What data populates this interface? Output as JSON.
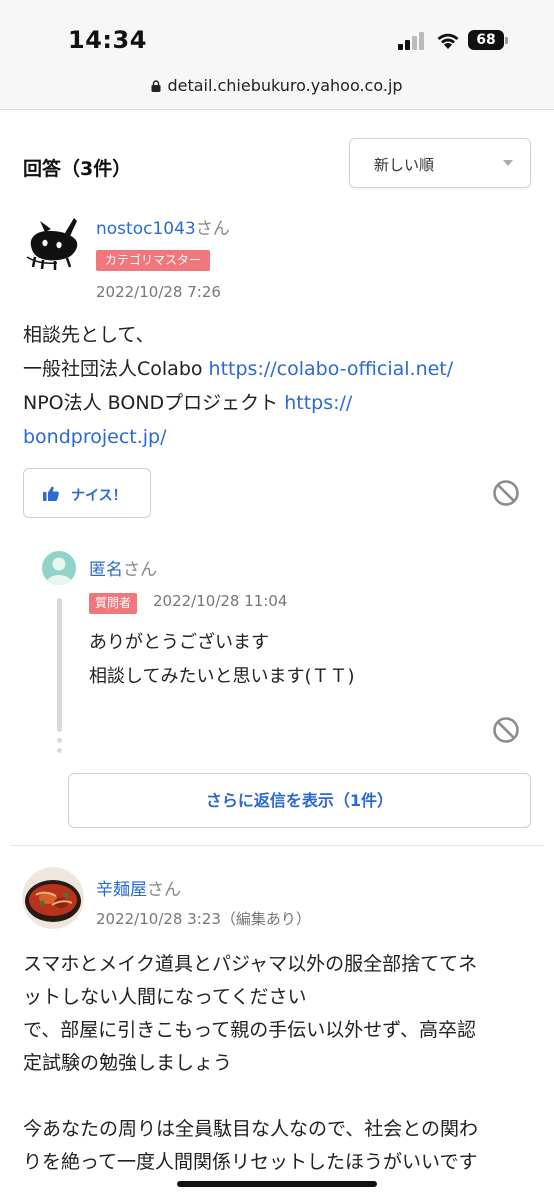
{
  "status_bar": {
    "time": "14:34",
    "battery": "68"
  },
  "browser": {
    "url": "detail.chiebukuro.yahoo.co.jp"
  },
  "answers_header": {
    "title": "回答（3件）",
    "sort_value": "新しい順"
  },
  "answer1": {
    "username": "nostoc1043",
    "suffix": "さん",
    "badge": "カテゴリマスター",
    "date": "2022/10/28 7:26",
    "lines": [
      {
        "text": "相談先として、",
        "link": ""
      },
      {
        "text": "一般社団法人Colabo ",
        "link": "https://colabo-official.net/"
      },
      {
        "text": "NPO法人 BONDプロジェクト ",
        "link": "https://"
      },
      {
        "text": "",
        "link": "bondproject.jp/"
      }
    ],
    "nice_label": "ナイス！"
  },
  "reply": {
    "username": "匿名",
    "suffix": "さん",
    "badge": "質問者",
    "date": "2022/10/28 11:04",
    "lines": [
      "ありがとうございます",
      "相談してみたいと思います(ＴＴ)"
    ],
    "more_label": "さらに返信を表示（1件）"
  },
  "answer2": {
    "username": "辛麺屋",
    "suffix": "さん",
    "date": "2022/10/28 3:23（編集あり）",
    "paragraph1": [
      "スマホとメイク道具とパジャマ以外の服全部捨ててネ",
      "ットしない人間になってください",
      "で、部屋に引きこもって親の手伝い以外せず、高卒認",
      "定試験の勉強しましょう"
    ],
    "paragraph2": [
      "今あなたの周りは全員駄目な人なので、社会との関わ",
      "りを絶って一度人間関係リセットしたほうがいいです"
    ]
  },
  "icons": {
    "lock": "lock-icon",
    "thumbs_up": "thumbs-up-icon",
    "ban": "ban-icon",
    "signal": "cellular-signal-icon",
    "wifi": "wifi-icon"
  },
  "colors": {
    "link": "#2a6ad1",
    "badge": "#f0787d",
    "reply_avatar": "#8fd3c9"
  }
}
